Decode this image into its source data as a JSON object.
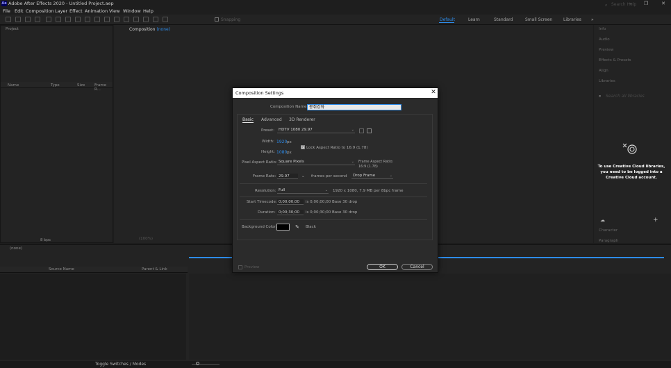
{
  "window": {
    "title": "Adobe After Effects 2020 - Untitled Project.aep",
    "logo": "Ae",
    "minimize": "–",
    "maximize": "❐",
    "close": "✕"
  },
  "menu": [
    "File",
    "Edit",
    "Composition",
    "Layer",
    "Effect",
    "Animation",
    "View",
    "Window",
    "Help"
  ],
  "toolbar": {
    "snapping": "Snapping",
    "workspaces": [
      "Default",
      "Learn",
      "Standard",
      "Small Screen",
      "Libraries"
    ],
    "more": "»",
    "search_placeholder": "Search Help"
  },
  "project_panel": {
    "tab": "Project",
    "columns": [
      "Name",
      "Type",
      "Size",
      "Frame R..."
    ],
    "bpc": "8 bpc"
  },
  "composition_panel": {
    "tab_prefix": "Composition",
    "tab_value": "(none)",
    "zoom": "(100%)"
  },
  "right_panel": {
    "items": [
      "Info",
      "Audio",
      "Preview",
      "Effects & Presets",
      "Align",
      "Libraries"
    ],
    "libraries_search": "Search all libraries",
    "cc_message": "To use Creative Cloud libraries, you need to be logged into a Creative Cloud account.",
    "bottom_items": [
      "Character",
      "Paragraph"
    ]
  },
  "timeline": {
    "tab": "(none)",
    "columns": [
      "Source Name",
      "Parent & Link"
    ],
    "toggle_label": "Toggle Switches / Modes"
  },
  "dialog": {
    "title": "Composition Settings",
    "close": "✕",
    "comp_name_label": "Composition Name:",
    "comp_name_value": "몽쥐강좌",
    "tabs": [
      "Basic",
      "Advanced",
      "3D Renderer"
    ],
    "preset_label": "Preset:",
    "preset_value": "HDTV 1080 29.97",
    "width_label": "Width:",
    "width_value": "1920",
    "height_label": "Height:",
    "height_value": "1080",
    "px": "px",
    "lock_label": "Lock Aspect Ratio to 16:9 (1.78)",
    "par_label": "Pixel Aspect Ratio:",
    "par_value": "Square Pixels",
    "frame_aspect_label": "Frame Aspect Ratio:",
    "frame_aspect_value": "16:9 (1.78)",
    "frame_rate_label": "Frame Rate:",
    "frame_rate_value": "29.97",
    "fps_label": "frames per second",
    "drop_frame": "Drop Frame",
    "resolution_label": "Resolution:",
    "resolution_value": "Full",
    "resolution_info": "1920 x 1080, 7.9 MB per 8bpc frame",
    "start_tc_label": "Start Timecode:",
    "start_tc_value": "0;00;00;00",
    "start_tc_info": "is 0;00;00;00  Base 30  drop",
    "duration_label": "Duration:",
    "duration_value": "0;00;30;00",
    "duration_info": "is 0;00;30;00  Base 30  drop",
    "bg_label": "Background Color:",
    "bg_color_name": "Black",
    "bg_color": "#000000",
    "preview_label": "Preview",
    "ok": "OK",
    "cancel": "Cancel"
  },
  "colors": {
    "accent": "#2d8ceb",
    "panel": "#232323",
    "dialog": "#2b2b2b"
  }
}
